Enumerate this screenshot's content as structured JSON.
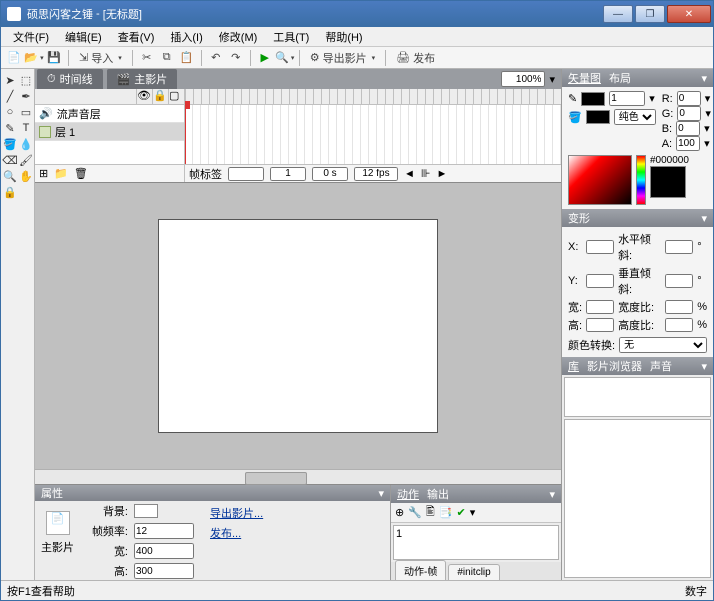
{
  "title": {
    "app": "硕思闪客之锤",
    "doc": "[无标题]"
  },
  "menu": {
    "file": "文件(F)",
    "edit": "编辑(E)",
    "view": "查看(V)",
    "insert": "插入(I)",
    "modify": "修改(M)",
    "tools": "工具(T)",
    "help": "帮助(H)"
  },
  "toolbar": {
    "import": "导入",
    "export_movie": "导出影片",
    "publish": "发布"
  },
  "tabs": {
    "timeline": "时间线",
    "main_movie": "主影片"
  },
  "zoom": {
    "value": "100%"
  },
  "layers": {
    "sound": "流声音层",
    "layer1": "层 1"
  },
  "tlstatus": {
    "frame_label": "帧标签",
    "frame": "1",
    "time": "0 s",
    "fps": "12 fps"
  },
  "vector": {
    "hdr": "矢量图",
    "layout": "布局",
    "r": "R:",
    "g": "G:",
    "b": "B:",
    "a": "A:",
    "r_v": "0",
    "g_v": "0",
    "b_v": "0",
    "a_v": "100",
    "stroke_w": "1",
    "fill_mode": "纯色",
    "hex": "#000000"
  },
  "transform": {
    "hdr": "变形",
    "x": "X:",
    "y": "Y:",
    "w": "宽:",
    "h": "高:",
    "hskew": "水平倾斜:",
    "vskew": "垂直倾斜:",
    "wratio": "宽度比:",
    "hratio": "高度比:",
    "deg": "°",
    "pct": "%",
    "colortrans": "颜色转换:",
    "none": "无"
  },
  "library": {
    "hdr1": "库",
    "hdr2": "影片浏览器",
    "hdr3": "声音"
  },
  "props": {
    "hdr": "属性",
    "bg": "背景:",
    "fps": "帧频率:",
    "fps_v": "12",
    "w": "宽:",
    "w_v": "400",
    "h": "高:",
    "h_v": "300",
    "type": "主影片",
    "link_export": "导出影片...",
    "link_publish": "发布..."
  },
  "actions": {
    "hdr1": "动作",
    "hdr2": "输出",
    "line": "1",
    "tab1": "动作-帧",
    "tab2": "#initclip"
  },
  "status": {
    "help": "按F1查看帮助",
    "num": "数字"
  }
}
